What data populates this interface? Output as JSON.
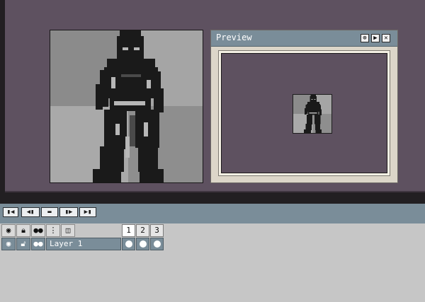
{
  "preview": {
    "title": "Preview"
  },
  "transport": {
    "buttons": [
      "first-frame",
      "previous-frame",
      "play",
      "next-frame",
      "last-frame"
    ]
  },
  "layers": {
    "header_icons": [
      "eye-icon",
      "lock-icon",
      "onion-skin-icon",
      "link-icon",
      "frame-icon"
    ],
    "frames": [
      "1",
      "2",
      "3"
    ],
    "items": [
      {
        "name": "Layer 1",
        "visible": true,
        "locked": false,
        "onion": true,
        "frame_cels": [
          true,
          true,
          true
        ]
      }
    ]
  },
  "colors": {
    "workspace_bg": "#5e5160",
    "panel_title": "#7a8d99",
    "panel_bg": "#c6c6c6"
  }
}
